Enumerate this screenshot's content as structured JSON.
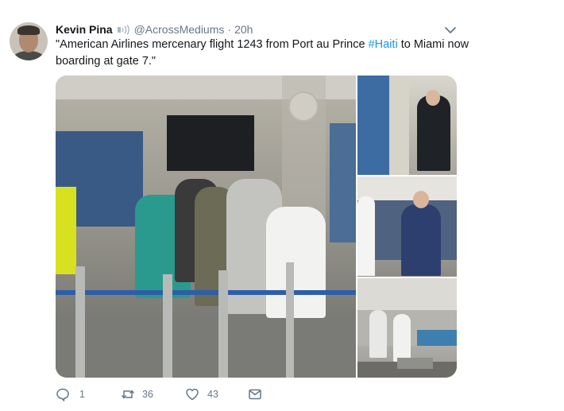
{
  "tweet": {
    "author_name": "Kevin Pina",
    "handle": "@AcrossMediums",
    "separator": "·",
    "time": "20h",
    "text_line1_pre": "\"American Airlines mercenary flight 1243 from Port au Prince ",
    "hashtag": "#Haiti",
    "text_line1_post": " to Miami now",
    "text_line2": "boarding at gate 7.\"",
    "verified_icon": "speaker-like-badge-icon",
    "more_icon": "chevron-down-icon"
  },
  "media": {
    "images": [
      "main-gate-photo",
      "thumb-top",
      "thumb-middle",
      "thumb-bottom"
    ]
  },
  "actions": {
    "reply_count": "1",
    "retweet_count": "36",
    "like_count": "43",
    "reply_icon": "reply-icon",
    "retweet_icon": "retweet-icon",
    "like_icon": "heart-icon",
    "dm_icon": "envelope-icon"
  },
  "colors": {
    "link": "#1b95e0",
    "muted": "#657786",
    "text": "#14171a"
  }
}
